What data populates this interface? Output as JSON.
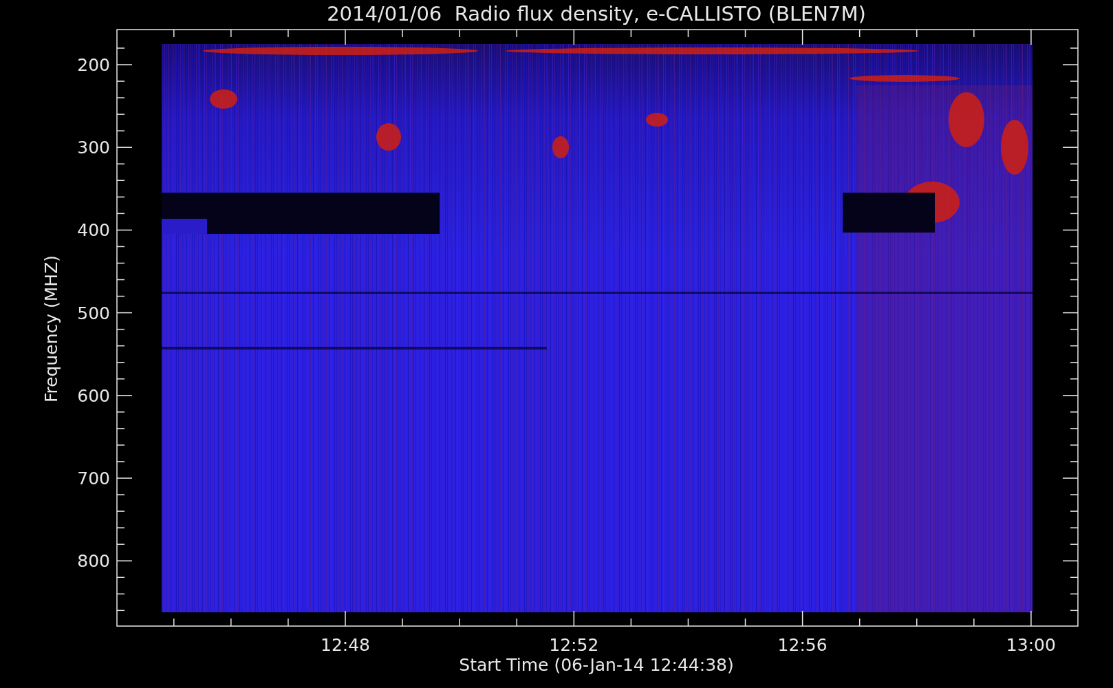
{
  "title": "2014/01/06  Radio flux density, e-CALLISTO (BLEN7M)",
  "y_axis": {
    "label": "Frequency (MHZ)",
    "ticks": [
      "200",
      "300",
      "400",
      "500",
      "600",
      "700",
      "800"
    ]
  },
  "x_axis": {
    "label": "Start Time (06-Jan-14 12:44:38)",
    "ticks": [
      "12:48",
      "12:52",
      "12:56",
      "13:00"
    ]
  }
}
